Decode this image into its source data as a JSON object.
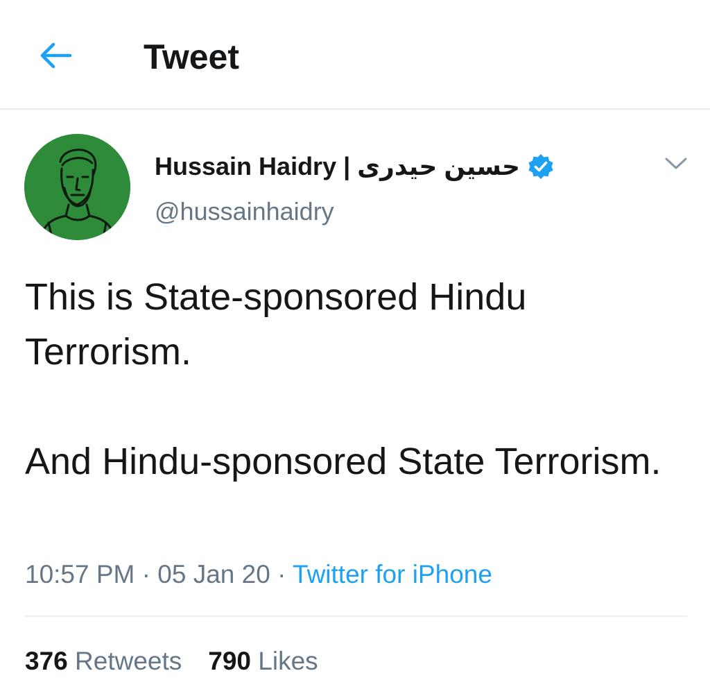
{
  "header": {
    "back_icon": "arrow-left-icon",
    "title": "Tweet"
  },
  "author": {
    "display_name": "Hussain Haidry | حسین حیدری",
    "handle": "@hussainhaidry",
    "verified_icon": "verified-badge-icon",
    "avatar_bg": "#2e8b3a"
  },
  "menu": {
    "icon": "chevron-down-icon"
  },
  "tweet": {
    "paragraph_1": "This is State-sponsored Hindu Terrorism.",
    "paragraph_2": "And Hindu-sponsored State Terrorism."
  },
  "meta": {
    "time": "10:57 PM",
    "separator_1": " · ",
    "date": "05 Jan 20",
    "separator_2": " · ",
    "source": "Twitter for iPhone"
  },
  "stats": {
    "retweets_count": "376",
    "retweets_label": "Retweets",
    "likes_count": "790",
    "likes_label": "Likes"
  },
  "colors": {
    "accent": "#1da1f2",
    "secondary_text": "#657786",
    "primary_text": "#14171a",
    "divider": "#e6ecf0"
  }
}
